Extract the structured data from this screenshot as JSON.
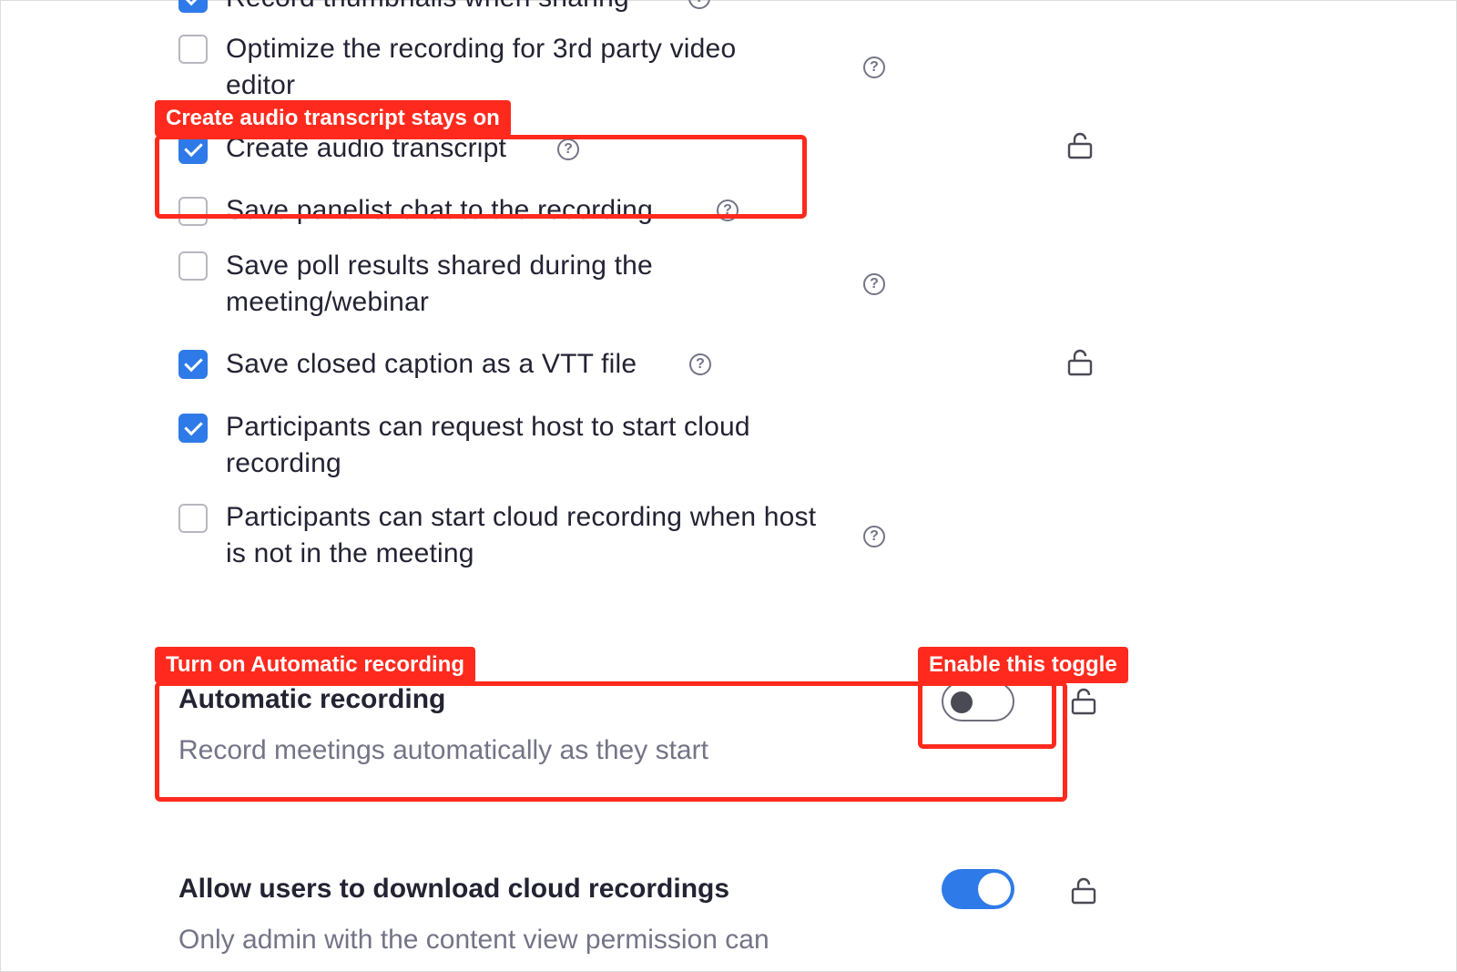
{
  "settings": {
    "top_partial": {
      "label": "Record thumbnails when sharing",
      "checked": true
    },
    "items": [
      {
        "label": "Optimize the recording for 3rd party video editor",
        "checked": false,
        "help": true,
        "lock": false
      },
      {
        "label": "Create audio transcript",
        "checked": true,
        "help": true,
        "lock": true
      },
      {
        "label": "Save panelist chat to the recording",
        "checked": false,
        "help": true,
        "lock": false
      },
      {
        "label": "Save poll results shared during the meeting/webinar",
        "checked": false,
        "help": true,
        "lock": false
      },
      {
        "label": "Save closed caption as a VTT file",
        "checked": true,
        "help": true,
        "lock": true
      },
      {
        "label": "Participants can request host to start cloud recording",
        "checked": true,
        "help": false,
        "lock": false
      },
      {
        "label": "Participants can start cloud recording when host is not in the meeting",
        "checked": false,
        "help": true,
        "lock": false
      }
    ],
    "automatic_recording": {
      "title": "Automatic recording",
      "description": "Record meetings automatically as they start",
      "enabled": false
    },
    "allow_download": {
      "title": "Allow users to download cloud recordings",
      "description": "Only admin with the content view permission can",
      "enabled": true
    }
  },
  "annotations": {
    "transcript": "Create audio transcript stays on",
    "auto_recording": "Turn on Automatic recording",
    "toggle": "Enable this toggle"
  },
  "icons": {
    "help": "question-circle-icon",
    "lock": "unlock-icon"
  },
  "colors": {
    "accent": "#2e7ae8",
    "annotation": "#ff2a1d"
  }
}
